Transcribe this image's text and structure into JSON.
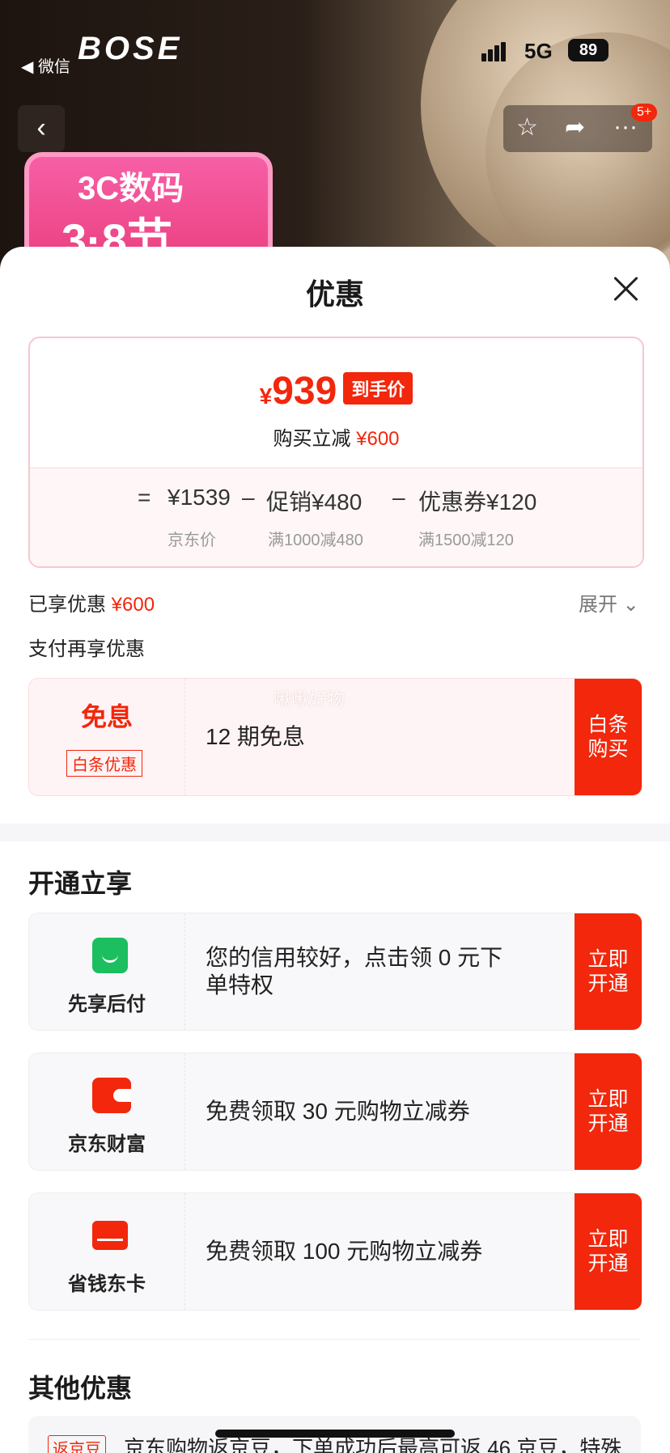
{
  "status_bar": {
    "back_app": "◀ 微信",
    "brand": "BOSE",
    "network": "5G",
    "battery": "89"
  },
  "nav": {
    "back_icon": "chevron-left-icon",
    "badge": "5+"
  },
  "promo_banner": {
    "line1": "3C数码",
    "line2": "3·8节"
  },
  "sheet": {
    "title": "优惠",
    "price": {
      "yen": "¥",
      "amount": "939",
      "tag": "到手价",
      "reduce_label": "购买立减",
      "reduce_amount": "¥600"
    },
    "breakdown": {
      "jd_price": "¥1539",
      "jd_label": "京东价",
      "promo_label": "促销",
      "promo_amount": "¥480",
      "promo_rule": "满1000减480",
      "coupon_label": "优惠券",
      "coupon_amount": "¥120",
      "coupon_rule": "满1500减120"
    },
    "enjoyed_label": "已享优惠",
    "enjoyed_amount": "¥600",
    "expand": "展开",
    "pay_more": "支付再享优惠",
    "baitiao": {
      "title": "免息",
      "tag": "白条优惠",
      "desc": "12 期免息",
      "cta": "白条购买",
      "watermark": "啾啾好物"
    },
    "open_section": "开通立享",
    "offers": [
      {
        "name": "先享后付",
        "desc": "您的信用较好，点击领 0 元下单特权",
        "cta": "立即开通",
        "icon": "green-bag-icon"
      },
      {
        "name": "京东财富",
        "desc": "免费领取 30 元购物立减券",
        "cta": "立即开通",
        "icon": "red-wallet-icon"
      },
      {
        "name": "省钱东卡",
        "desc": "免费领取 100 元购物立减券",
        "cta": "立即开通",
        "icon": "red-card-icon"
      }
    ],
    "other_section": "其他优惠",
    "other": {
      "tag": "返京豆",
      "text": "京东购物返京豆，下单成功后最高可返 46 京豆，特殊"
    }
  }
}
